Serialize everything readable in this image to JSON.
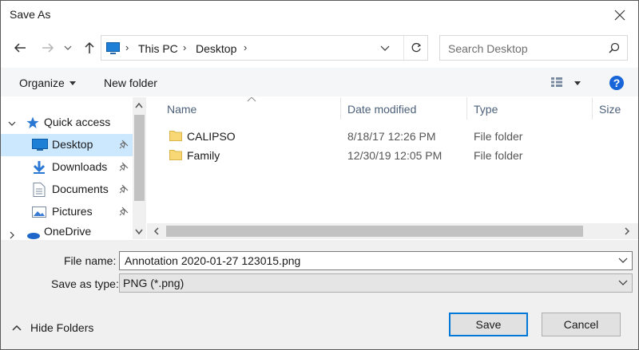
{
  "window": {
    "title": "Save As"
  },
  "address": {
    "crumbs": [
      "This PC",
      "Desktop"
    ],
    "search_placeholder": "Search Desktop"
  },
  "toolbar": {
    "organize": "Organize",
    "new_folder": "New folder"
  },
  "nav": {
    "quick_access": "Quick access",
    "items": [
      {
        "label": "Desktop",
        "icon": "desktop-icon",
        "pinned": true,
        "selected": true
      },
      {
        "label": "Downloads",
        "icon": "downloads-icon",
        "pinned": true
      },
      {
        "label": "Documents",
        "icon": "documents-icon",
        "pinned": true
      },
      {
        "label": "Pictures",
        "icon": "pictures-icon",
        "pinned": true
      },
      {
        "label": "OneDrive",
        "icon": "onedrive-icon"
      }
    ]
  },
  "columns": {
    "name": "Name",
    "date": "Date modified",
    "type": "Type",
    "size": "Size"
  },
  "files": [
    {
      "name": "CALIPSO",
      "date": "8/18/17 12:26 PM",
      "type": "File folder"
    },
    {
      "name": "Family",
      "date": "12/30/19 12:05 PM",
      "type": "File folder"
    }
  ],
  "form": {
    "file_name_label": "File name:",
    "file_name_value": "Annotation 2020-01-27 123015.png",
    "save_type_label": "Save as type:",
    "save_type_value": "PNG (*.png)",
    "hide_folders": "Hide Folders",
    "save": "Save",
    "cancel": "Cancel"
  },
  "colors": {
    "accent": "#0078d7",
    "selection": "#cce8ff",
    "folder": "#f8d775"
  }
}
